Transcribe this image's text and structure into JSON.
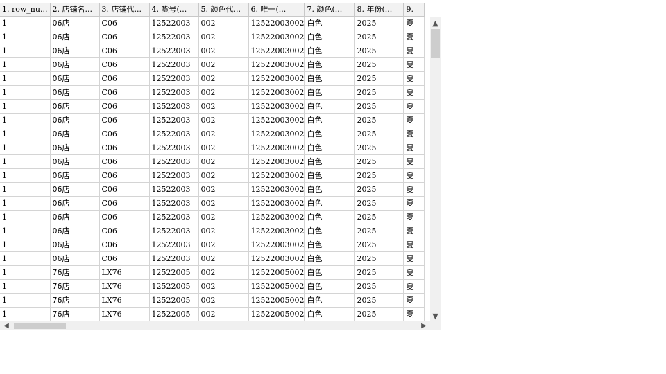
{
  "columns": [
    "1. row_nu...",
    "2. 店铺名...",
    "3. 店铺代...",
    "4. 货号(...",
    "5. 颜色代...",
    "6. 唯一(...",
    "7. 颜色(...",
    "8. 年份(...",
    "9."
  ],
  "rows": [
    [
      "1",
      "06店",
      "C06",
      "12522003",
      "002",
      "12522003002",
      "白色",
      "2025",
      "夏"
    ],
    [
      "1",
      "06店",
      "C06",
      "12522003",
      "002",
      "12522003002",
      "白色",
      "2025",
      "夏"
    ],
    [
      "1",
      "06店",
      "C06",
      "12522003",
      "002",
      "12522003002",
      "白色",
      "2025",
      "夏"
    ],
    [
      "1",
      "06店",
      "C06",
      "12522003",
      "002",
      "12522003002",
      "白色",
      "2025",
      "夏"
    ],
    [
      "1",
      "06店",
      "C06",
      "12522003",
      "002",
      "12522003002",
      "白色",
      "2025",
      "夏"
    ],
    [
      "1",
      "06店",
      "C06",
      "12522003",
      "002",
      "12522003002",
      "白色",
      "2025",
      "夏"
    ],
    [
      "1",
      "06店",
      "C06",
      "12522003",
      "002",
      "12522003002",
      "白色",
      "2025",
      "夏"
    ],
    [
      "1",
      "06店",
      "C06",
      "12522003",
      "002",
      "12522003002",
      "白色",
      "2025",
      "夏"
    ],
    [
      "1",
      "06店",
      "C06",
      "12522003",
      "002",
      "12522003002",
      "白色",
      "2025",
      "夏"
    ],
    [
      "1",
      "06店",
      "C06",
      "12522003",
      "002",
      "12522003002",
      "白色",
      "2025",
      "夏"
    ],
    [
      "1",
      "06店",
      "C06",
      "12522003",
      "002",
      "12522003002",
      "白色",
      "2025",
      "夏"
    ],
    [
      "1",
      "06店",
      "C06",
      "12522003",
      "002",
      "12522003002",
      "白色",
      "2025",
      "夏"
    ],
    [
      "1",
      "06店",
      "C06",
      "12522003",
      "002",
      "12522003002",
      "白色",
      "2025",
      "夏"
    ],
    [
      "1",
      "06店",
      "C06",
      "12522003",
      "002",
      "12522003002",
      "白色",
      "2025",
      "夏"
    ],
    [
      "1",
      "06店",
      "C06",
      "12522003",
      "002",
      "12522003002",
      "白色",
      "2025",
      "夏"
    ],
    [
      "1",
      "06店",
      "C06",
      "12522003",
      "002",
      "12522003002",
      "白色",
      "2025",
      "夏"
    ],
    [
      "1",
      "06店",
      "C06",
      "12522003",
      "002",
      "12522003002",
      "白色",
      "2025",
      "夏"
    ],
    [
      "1",
      "06店",
      "C06",
      "12522003",
      "002",
      "12522003002",
      "白色",
      "2025",
      "夏"
    ],
    [
      "1",
      "76店",
      "LX76",
      "12522005",
      "002",
      "12522005002",
      "白色",
      "2025",
      "夏"
    ],
    [
      "1",
      "76店",
      "LX76",
      "12522005",
      "002",
      "12522005002",
      "白色",
      "2025",
      "夏"
    ],
    [
      "1",
      "76店",
      "LX76",
      "12522005",
      "002",
      "12522005002",
      "白色",
      "2025",
      "夏"
    ],
    [
      "1",
      "76店",
      "LX76",
      "12522005",
      "002",
      "12522005002",
      "白色",
      "2025",
      "夏"
    ]
  ],
  "scrollbars": {
    "up_icon": "▲",
    "down_icon": "▼",
    "left_icon": "◀",
    "right_icon": "▶",
    "vertical_position": 0.0,
    "horizontal_position": 0.0
  },
  "colors": {
    "header_bg": "#f2f2f2",
    "grid_line": "#d4d4d4",
    "scrollbar_bg": "#f0f0f0",
    "scrollbar_thumb": "#cdcdcd"
  }
}
